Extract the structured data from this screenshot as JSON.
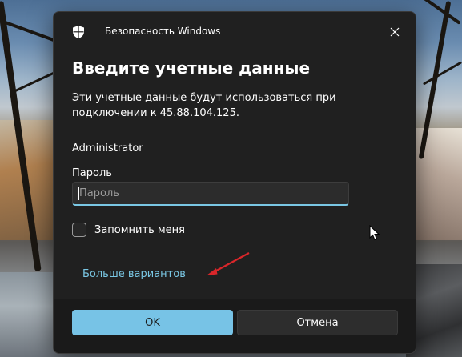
{
  "dialog": {
    "app_title": "Безопасность Windows",
    "heading": "Введите учетные данные",
    "description": "Эти учетные данные будут использоваться при подключении к 45.88.104.125.",
    "username": "Administrator",
    "password_label": "Пароль",
    "password_placeholder": "Пароль",
    "password_value": "",
    "remember_label": "Запомнить меня",
    "remember_checked": false,
    "more_options": "Больше вариантов",
    "ok_label": "OK",
    "cancel_label": "Отмена"
  },
  "icons": {
    "app": "shield-icon",
    "close": "close-icon",
    "annotation": "red-arrow-icon",
    "pointer": "mouse-cursor-icon"
  },
  "colors": {
    "dialog_bg": "#202020",
    "footer_bg": "#1a1a1a",
    "accent": "#77c3e6",
    "link": "#7ac7e4",
    "annotation": "#d9262a"
  }
}
